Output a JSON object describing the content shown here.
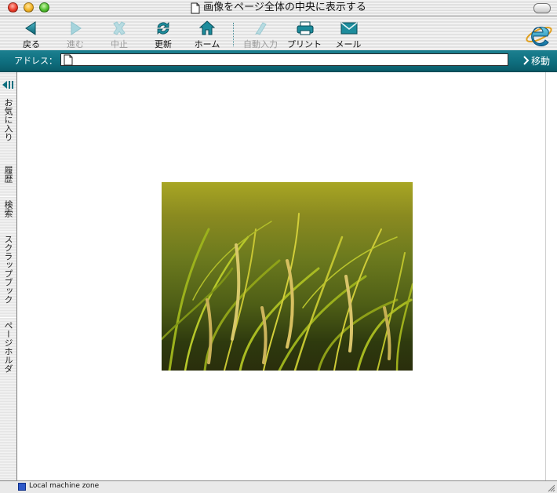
{
  "window": {
    "title": "画像をページ全体の中央に表示する"
  },
  "toolbar": {
    "buttons": [
      {
        "id": "back",
        "label": "戻る",
        "icon": "back-arrow-icon",
        "enabled": true
      },
      {
        "id": "forward",
        "label": "進む",
        "icon": "forward-arrow-icon",
        "enabled": false
      },
      {
        "id": "stop",
        "label": "中止",
        "icon": "stop-x-icon",
        "enabled": false
      },
      {
        "id": "refresh",
        "label": "更新",
        "icon": "refresh-icon",
        "enabled": true
      },
      {
        "id": "home",
        "label": "ホーム",
        "icon": "home-icon",
        "enabled": true
      },
      {
        "id": "autofill",
        "label": "自動入力",
        "icon": "autofill-icon",
        "enabled": false
      },
      {
        "id": "print",
        "label": "プリント",
        "icon": "printer-icon",
        "enabled": true
      },
      {
        "id": "mail",
        "label": "メール",
        "icon": "mail-icon",
        "enabled": true
      }
    ]
  },
  "address": {
    "label": "アドレス：",
    "value": "",
    "go_label": "移動"
  },
  "sidebar": {
    "tabs": [
      {
        "label": "お気に入り"
      },
      {
        "label": "履歴"
      },
      {
        "label": "検索"
      },
      {
        "label": "スクラップブック"
      },
      {
        "label": "ページホルダ"
      }
    ]
  },
  "content": {
    "image_alt": "rice field photo"
  },
  "status": {
    "zone_text": "Local machine zone"
  },
  "colors": {
    "accent_teal": "#0f6f7f",
    "icon_teal": "#1a8a9a"
  }
}
